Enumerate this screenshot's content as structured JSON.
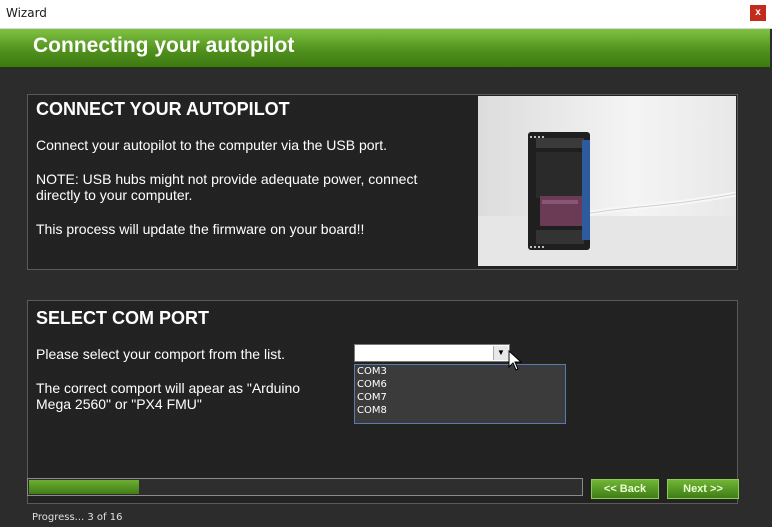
{
  "window": {
    "title": "Wizard",
    "close_label": "x"
  },
  "header": {
    "title": "Connecting your autopilot"
  },
  "connect": {
    "heading": "CONNECT YOUR AUTOPILOT",
    "line1": "Connect your autopilot to the computer via the USB port.",
    "line2a": "NOTE: USB hubs might not provide adequate power, connect",
    "line2b": "directly to your computer.",
    "line3": "This process will update the firmware on your board!!",
    "board_label": "AUTOPILOT"
  },
  "comport": {
    "heading": "SELECT COM PORT",
    "instruction": "Please select your comport from the list.",
    "hint_a": "The correct comport will apear as \"Arduino",
    "hint_b": "Mega 2560\" or \"PX4 FMU\"",
    "selected_value": "",
    "options": [
      "COM3",
      "COM6",
      "COM7",
      "COM8"
    ]
  },
  "footer": {
    "back_label": "<< Back",
    "next_label": "Next >>",
    "progress_fraction": 0.2,
    "status": "Progress... 3 of 16"
  },
  "colors": {
    "accent": "#4e8e1c",
    "background": "#2a2a2a",
    "close": "#c42b1c"
  }
}
